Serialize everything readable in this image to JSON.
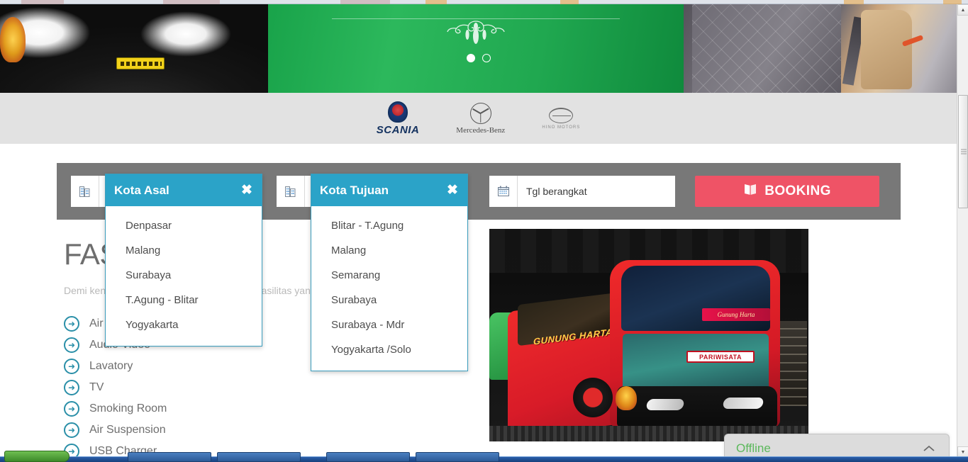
{
  "hero": {
    "carousel": {
      "slide_count": 2,
      "active_index": 0,
      "dots": [
        "dot-1",
        "dot-2"
      ]
    },
    "ornament": "❦"
  },
  "brands": [
    {
      "name": "SCANIA",
      "wordmark": "SCANIA",
      "icon": "scania-logo-icon"
    },
    {
      "name": "Mercedes-Benz",
      "wordmark": "Mercedes-Benz",
      "icon": "mercedes-benz-logo-icon"
    },
    {
      "name": "Hino",
      "wordmark": "HINO MOTORS",
      "icon": "hino-logo-icon"
    }
  ],
  "booking": {
    "origin_field": {
      "icon": "building-icon",
      "value": "",
      "placeholder": "Kota Asal"
    },
    "dest_field": {
      "icon": "building-icon",
      "value": "",
      "placeholder": "Kota Tujuan"
    },
    "date_field": {
      "icon": "calendar-icon",
      "value": "Tgl berangkat",
      "placeholder": "Tgl berangkat"
    },
    "submit_label": "BOOKING",
    "submit_icon": "book-icon",
    "accent_color": "#ef5366",
    "bar_color": "#787878"
  },
  "dropdowns": {
    "origin": {
      "title": "Kota Asal",
      "close_icon": "close-icon",
      "header_color": "#2ba3c8",
      "items": [
        "Denpasar",
        "Malang",
        "Surabaya",
        "T.Agung - Blitar",
        "Yogyakarta"
      ]
    },
    "destination": {
      "title": "Kota Tujuan",
      "close_icon": "close-icon",
      "header_color": "#2ba3c8",
      "items": [
        "Blitar - T.Agung",
        "Malang",
        "Semarang",
        "Surabaya",
        "Surabaya - Mdr",
        "Yogyakarta /Solo"
      ]
    }
  },
  "fasilitas": {
    "title": "FASILITAS",
    "description": "Demi kenyamanan perjalanan anda, berikut fasilitas yang kami mengerti diantaranya :",
    "bullet_icon": "arrow-circle-right-icon",
    "items": [
      "Air Conditioner",
      "Audio Video",
      "Lavatory",
      "TV",
      "Smoking Room",
      "Air Suspension",
      "USB Charger"
    ]
  },
  "bus_photo": {
    "alt": "Gunung Harta tourism bus",
    "brand_text": "GUNUNG HARTA",
    "nameplate_text": "Gunung Harta",
    "sign_text": "PARIWISATA"
  },
  "chat": {
    "status_label": "Offline",
    "status_color": "#5cb85c",
    "toggle_icon": "chevron-up-icon"
  },
  "scrollbar": {
    "up_icon": "triangle-up-icon",
    "down_icon": "triangle-down-icon"
  }
}
